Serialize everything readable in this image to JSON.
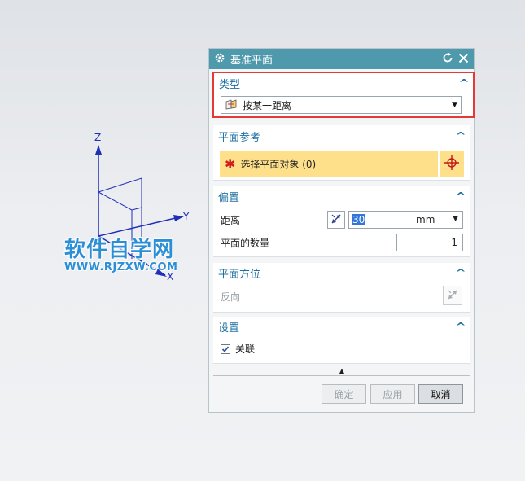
{
  "viewport": {
    "axis_labels": {
      "z": "Z",
      "y": "Y",
      "x": "X"
    },
    "watermark_title": "软件自学网",
    "watermark_url": "WWW.RJZXW.COM",
    "axis_color": "#1f2fb8"
  },
  "dialog": {
    "title": "基准平面",
    "title_icon": "gear-icon",
    "reset_icon": "reset-icon",
    "close_icon": "close-icon",
    "sections": {
      "type": {
        "title": "类型",
        "selected": "按某一距离"
      },
      "plane_ref": {
        "title": "平面参考",
        "select_label": "选择平面对象 (0)"
      },
      "offset": {
        "title": "偏置",
        "distance_label": "距离",
        "distance_value": "30",
        "unit": "mm",
        "count_label": "平面的数量",
        "count_value": "1"
      },
      "orientation": {
        "title": "平面方位",
        "reverse_label": "反向"
      },
      "settings": {
        "title": "设置",
        "associative_label": "关联",
        "associative_checked": true
      }
    },
    "buttons": {
      "ok": "确定",
      "apply": "应用",
      "cancel": "取消"
    },
    "colors": {
      "titlebar": "#4f99ad",
      "section_title": "#1e6fa0",
      "highlight": "#ffe08a",
      "required": "#d21e1e",
      "type_border": "#e53935"
    }
  }
}
